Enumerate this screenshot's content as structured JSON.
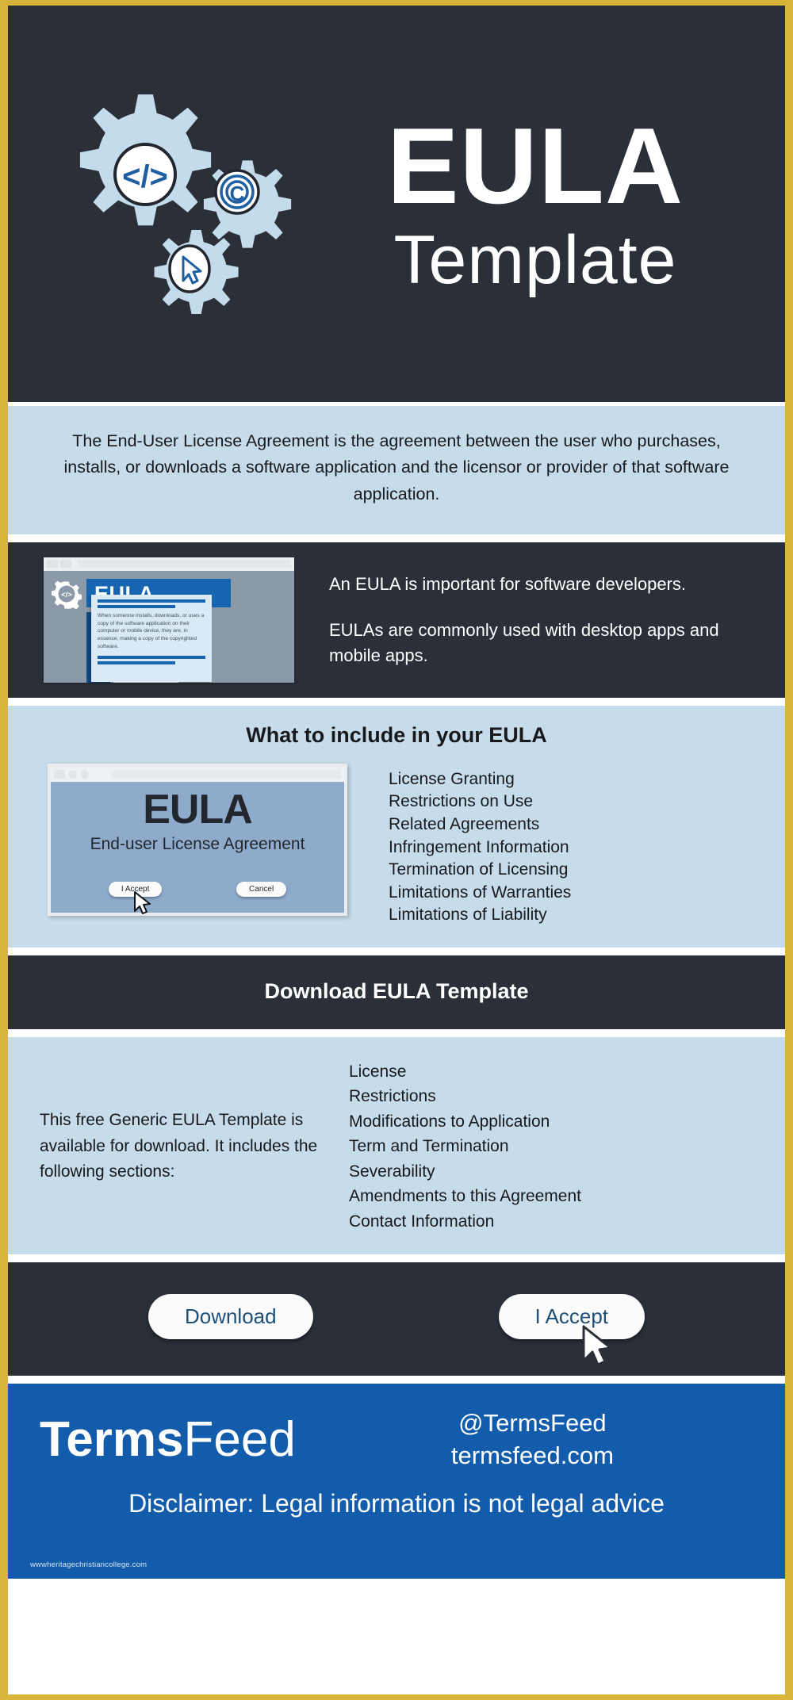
{
  "theme": {
    "frame_border": "#d9b43a",
    "dark_bg": "#2b2f38",
    "light_blue_bg": "#c7dcea",
    "brand_blue": "#135cab",
    "accent_blue": "#1565b0"
  },
  "hero": {
    "title": "EULA",
    "subtitle": "Template",
    "icons": {
      "code_gear": "code-gear-icon",
      "copyright_gear": "copyright-gear-icon",
      "cursor_gear": "cursor-gear-icon"
    }
  },
  "intro": {
    "text": "The End-User License Agreement  is the agreement between the user who purchases, installs, or downloads a software application and the licensor or provider of that software application."
  },
  "importance": {
    "paragraphs": [
      "An EULA is important for software developers.",
      "EULAs are commonly used with desktop apps and mobile apps."
    ],
    "mockup": {
      "title": "EULA",
      "body_text": "When someone installs, downloads, or uses a copy of the software application on their computer or mobile device, they are, in essence, making a copy of the copyrighted software.",
      "gear_icon": "code-gear-icon",
      "copyright_icon": "copyright-icon"
    }
  },
  "include": {
    "heading": "What to include in your EULA",
    "items": [
      "License Granting",
      "Restrictions on Use",
      "Related Agreements",
      "Infringement Information",
      "Termination of Licensing",
      "Limitations of Warranties",
      "Limitations of Liability"
    ],
    "mockup": {
      "title": "EULA",
      "subtitle": "End-user License Agreement",
      "accept_button": "I Accept",
      "cancel_button": "Cancel",
      "cursor_icon": "mouse-pointer-icon"
    }
  },
  "download": {
    "heading": "Download EULA Template",
    "description": "This free Generic EULA Template is available for download. It includes the following sections:",
    "sections": [
      "License",
      "Restrictions",
      "Modifications to Application",
      "Term and Termination",
      "Severability",
      "Amendments to this Agreement",
      "Contact Information"
    ]
  },
  "actions": {
    "download_button": "Download",
    "accept_button": "I Accept",
    "cursor_icon": "mouse-pointer-icon"
  },
  "footer": {
    "brand_bold": "Terms",
    "brand_light": "Feed",
    "handle": "@TermsFeed",
    "website": "termsfeed.com",
    "disclaimer": "Disclaimer: Legal information is not legal advice",
    "watermark": "wwwheritagechristiancollege.com"
  }
}
